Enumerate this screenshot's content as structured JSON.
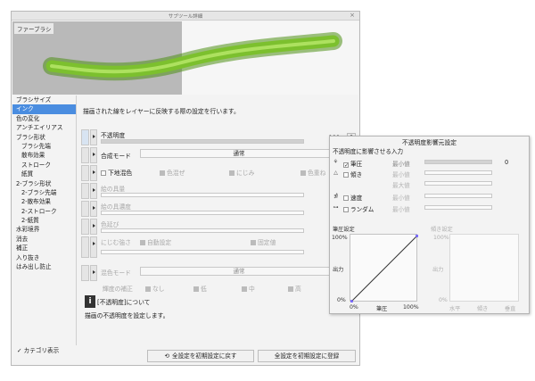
{
  "window": {
    "title": "サブツール詳細",
    "close": "×"
  },
  "preview": {
    "brush_name": "ファーブラシ",
    "stroke_color": "#7cc02e"
  },
  "categories": [
    {
      "label": "ブラシサイズ",
      "indent": false,
      "selected": false
    },
    {
      "label": "インク",
      "indent": false,
      "selected": true
    },
    {
      "label": "色の変化",
      "indent": false,
      "selected": false
    },
    {
      "label": "アンチエイリアス",
      "indent": false,
      "selected": false
    },
    {
      "label": "ブラシ形状",
      "indent": false,
      "selected": false
    },
    {
      "label": "ブラシ先端",
      "indent": true,
      "selected": false
    },
    {
      "label": "散布効果",
      "indent": true,
      "selected": false
    },
    {
      "label": "ストローク",
      "indent": true,
      "selected": false
    },
    {
      "label": "紙質",
      "indent": true,
      "selected": false
    },
    {
      "label": "2-ブラシ形状",
      "indent": false,
      "selected": false
    },
    {
      "label": "2-ブラシ先端",
      "indent": true,
      "selected": false
    },
    {
      "label": "2-散布効果",
      "indent": true,
      "selected": false
    },
    {
      "label": "2-ストローク",
      "indent": true,
      "selected": false
    },
    {
      "label": "2-紙質",
      "indent": true,
      "selected": false
    },
    {
      "label": "水彩境界",
      "indent": false,
      "selected": false
    },
    {
      "label": "消去",
      "indent": false,
      "selected": false
    },
    {
      "label": "補正",
      "indent": false,
      "selected": false
    },
    {
      "label": "入り抜き",
      "indent": false,
      "selected": false
    },
    {
      "label": "はみ出し防止",
      "indent": false,
      "selected": false
    }
  ],
  "show_category": {
    "label": "カテゴリ表示",
    "checked": "✓"
  },
  "content": {
    "description": "描画された線をレイヤーに反映する際の設定を行います。",
    "opacity": {
      "label": "不透明度",
      "value": "100",
      "fill": 1.0
    },
    "blend": {
      "label": "合成モード",
      "value": "通常"
    },
    "underlay": {
      "label": "下地混色",
      "opt1": "色混ぜ",
      "opt2": "にじみ",
      "opt3": "色重ね"
    },
    "paint_amount": {
      "label": "絵の具量"
    },
    "paint_density": {
      "label": "絵の具濃度"
    },
    "color_stretch": {
      "label": "色延び"
    },
    "blur": {
      "label": "にじむ強さ",
      "auto": "自動設定",
      "fixed": "固定値"
    },
    "mix_mode": {
      "label": "混色モード",
      "value": "通常"
    },
    "luminance": {
      "label": "輝度の補正",
      "opts": [
        "なし",
        "低",
        "中",
        "高"
      ]
    },
    "info_title": "[不透明度]について",
    "info_body": "描画の不透明度を設定します。"
  },
  "buttons": {
    "reset": "全設定を初期設定に戻す",
    "register": "全設定を初期設定に登録"
  },
  "panel": {
    "title": "不透明度影響元設定",
    "subtitle": "不透明度に影響させる入力",
    "rows": [
      {
        "icon": "⚘",
        "checked": true,
        "label": "筆圧",
        "min_label": "最小値",
        "fill": 1.0,
        "value": "0",
        "enabled": true
      },
      {
        "icon": "△",
        "checked": false,
        "label": "傾き",
        "min_label": "最小値",
        "fill": 0.0,
        "value": "",
        "enabled": false
      },
      {
        "icon": "",
        "checked": false,
        "label": "",
        "min_label": "最大値",
        "fill": 0.0,
        "value": "",
        "enabled": false
      },
      {
        "icon": "⋬",
        "checked": false,
        "label": "速度",
        "min_label": "最小値",
        "fill": 0.0,
        "value": "",
        "enabled": false
      },
      {
        "icon": "⊶",
        "checked": false,
        "label": "ランダム",
        "min_label": "最小値",
        "fill": 0.0,
        "value": "",
        "enabled": false
      }
    ],
    "pressure_graph": {
      "title": "筆圧設定",
      "y_top": "100%",
      "y_label": "出力",
      "y_bottom": "0%",
      "x_left": "0%",
      "x_label": "筆圧",
      "x_right": "100%"
    },
    "tilt_graph": {
      "title": "傾き設定",
      "y_top": "100%",
      "y_label": "出力",
      "y_bottom": "0%",
      "x_left": "水平",
      "x_label": "傾き",
      "x_right": "垂直"
    }
  }
}
